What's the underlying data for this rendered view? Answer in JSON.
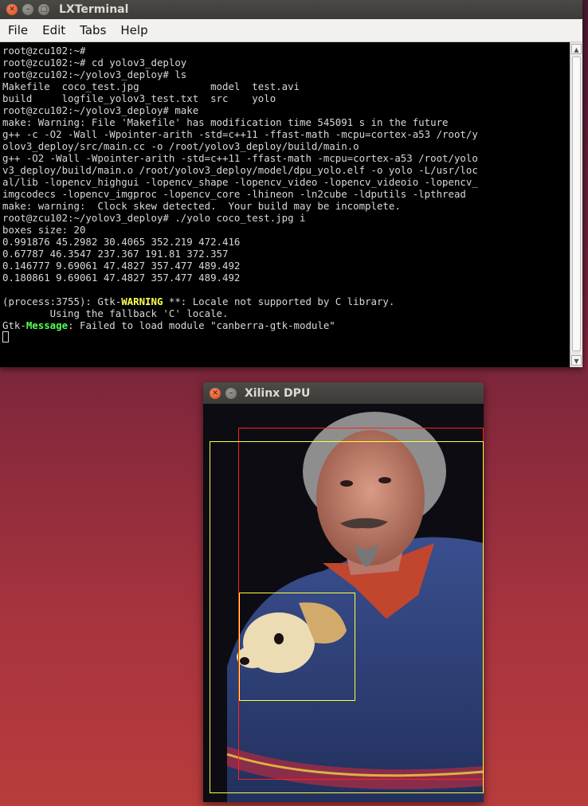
{
  "terminal": {
    "title": "LXTerminal",
    "menu": [
      "File",
      "Edit",
      "Tabs",
      "Help"
    ],
    "lines_before_warning": [
      "root@zcu102:~#",
      "root@zcu102:~# cd yolov3_deploy",
      "root@zcu102:~/yolov3_deploy# ls",
      "Makefile  coco_test.jpg            model  test.avi",
      "build     logfile_yolov3_test.txt  src    yolo",
      "root@zcu102:~/yolov3_deploy# make",
      "make: Warning: File 'Makefile' has modification time 545091 s in the future",
      "g++ -c -O2 -Wall -Wpointer-arith -std=c++11 -ffast-math -mcpu=cortex-a53 /root/y",
      "olov3_deploy/src/main.cc -o /root/yolov3_deploy/build/main.o",
      "g++ -O2 -Wall -Wpointer-arith -std=c++11 -ffast-math -mcpu=cortex-a53 /root/yolo",
      "v3_deploy/build/main.o /root/yolov3_deploy/model/dpu_yolo.elf -o yolo -L/usr/loc",
      "al/lib -lopencv_highgui -lopencv_shape -lopencv_video -lopencv_videoio -lopencv_",
      "imgcodecs -lopencv_imgproc -lopencv_core -lhineon -ln2cube -ldputils -lpthread",
      "make: warning:  Clock skew detected.  Your build may be incomplete.",
      "root@zcu102:~/yolov3_deploy# ./yolo coco_test.jpg i",
      "boxes size: 20",
      "0.991876 45.2982 30.4065 352.219 472.416",
      "0.67787 46.3547 237.367 191.81 372.357",
      "0.146777 9.69061 47.4827 357.477 489.492",
      "0.180861 9.69061 47.4827 357.477 489.492",
      ""
    ],
    "gtk_warning_prefix": "(process:3755): Gtk-",
    "gtk_warning_word": "WARNING",
    "gtk_warning_rest": " **: Locale not supported by C library.",
    "fallback_line": "        Using the fallback 'C' locale.",
    "gtk_msg_prefix": "Gtk-",
    "gtk_msg_word": "Message",
    "gtk_msg_rest": ": Failed to load module \"canberra-gtk-module\""
  },
  "dpu": {
    "title": "Xilinx DPU",
    "box_colors": {
      "person": "#ff2020",
      "overlap": "#ffff40",
      "dog": "#ffff40"
    }
  }
}
